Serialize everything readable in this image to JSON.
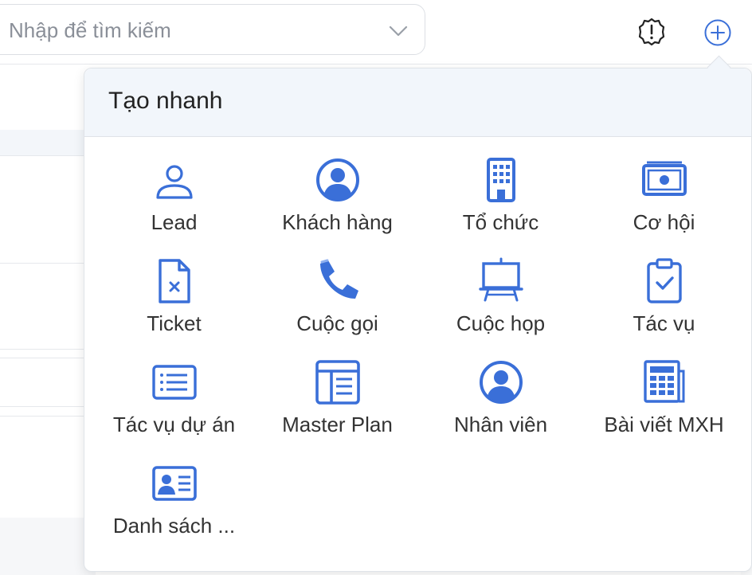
{
  "search": {
    "placeholder": "Nhập để tìm kiếm"
  },
  "popover": {
    "title": "Tạo nhanh",
    "items": [
      {
        "label": "Lead",
        "icon": "user-outline-icon"
      },
      {
        "label": "Khách hàng",
        "icon": "user-circle-icon"
      },
      {
        "label": "Tổ chức",
        "icon": "building-icon"
      },
      {
        "label": "Cơ hội",
        "icon": "money-bill-icon"
      },
      {
        "label": "Ticket",
        "icon": "file-x-icon"
      },
      {
        "label": "Cuộc gọi",
        "icon": "phone-icon"
      },
      {
        "label": "Cuộc họp",
        "icon": "presentation-board-icon"
      },
      {
        "label": "Tác vụ",
        "icon": "clipboard-check-icon"
      },
      {
        "label": "Tác vụ dự án",
        "icon": "list-icon"
      },
      {
        "label": "Master Plan",
        "icon": "layout-table-icon"
      },
      {
        "label": "Nhân viên",
        "icon": "employee-circle-icon"
      },
      {
        "label": "Bài viết MXH",
        "icon": "newspaper-icon"
      },
      {
        "label": "Danh sách ...",
        "icon": "contact-card-icon"
      }
    ]
  },
  "colors": {
    "accent": "#3a6fd8",
    "header_bg": "#f2f6fb",
    "border": "#dfe3e8"
  }
}
